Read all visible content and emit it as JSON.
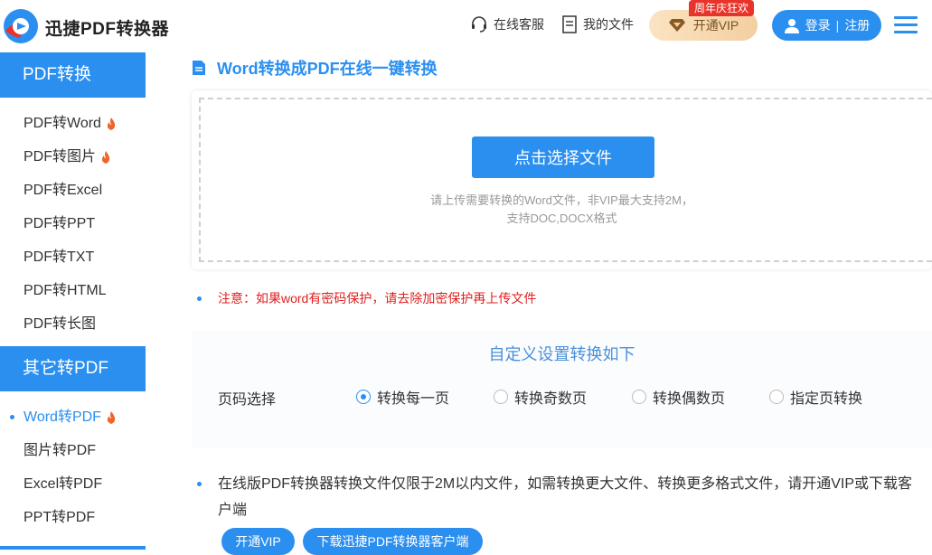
{
  "header": {
    "brand": "迅捷PDF转换器",
    "service": "在线客服",
    "my_files": "我的文件",
    "vip_badge": "周年庆狂欢",
    "vip_button": "开通VIP",
    "login": "登录",
    "register": "注册"
  },
  "sidebar": {
    "group1_title": "PDF转换",
    "group1_items": [
      {
        "label": "PDF转Word",
        "hot": true
      },
      {
        "label": "PDF转图片",
        "hot": true
      },
      {
        "label": "PDF转Excel",
        "hot": false
      },
      {
        "label": "PDF转PPT",
        "hot": false
      },
      {
        "label": "PDF转TXT",
        "hot": false
      },
      {
        "label": "PDF转HTML",
        "hot": false
      },
      {
        "label": "PDF转长图",
        "hot": false
      }
    ],
    "group2_title": "其它转PDF",
    "group2_items": [
      {
        "label": "Word转PDF",
        "hot": true,
        "active": true
      },
      {
        "label": "图片转PDF",
        "hot": false
      },
      {
        "label": "Excel转PDF",
        "hot": false
      },
      {
        "label": "PPT转PDF",
        "hot": false
      }
    ]
  },
  "main": {
    "title": "Word转换成PDF在线一键转换",
    "choose_button": "点击选择文件",
    "hint_line1": "请上传需要转换的Word文件，非VIP最大支持2M，",
    "hint_line2": "支持DOC,DOCX格式",
    "note": "注意：如果word有密码保护，请去除加密保护再上传文件",
    "settings_title": "自定义设置转换如下",
    "page_select_label": "页码选择",
    "options": [
      {
        "label": "转换每一页",
        "selected": true
      },
      {
        "label": "转换奇数页",
        "selected": false
      },
      {
        "label": "转换偶数页",
        "selected": false
      },
      {
        "label": "指定页转换",
        "selected": false
      }
    ],
    "info_text": "在线版PDF转换器转换文件仅限于2M以内文件，如需转换更大文件、转换更多格式文件，请开通VIP或下载客户端",
    "btn_vip": "开通VIP",
    "btn_download": "下载迅捷PDF转换器客户端"
  },
  "colors": {
    "accent": "#2b8ff0",
    "warning": "#e02020",
    "vip_gold": "#f3cfa1"
  }
}
